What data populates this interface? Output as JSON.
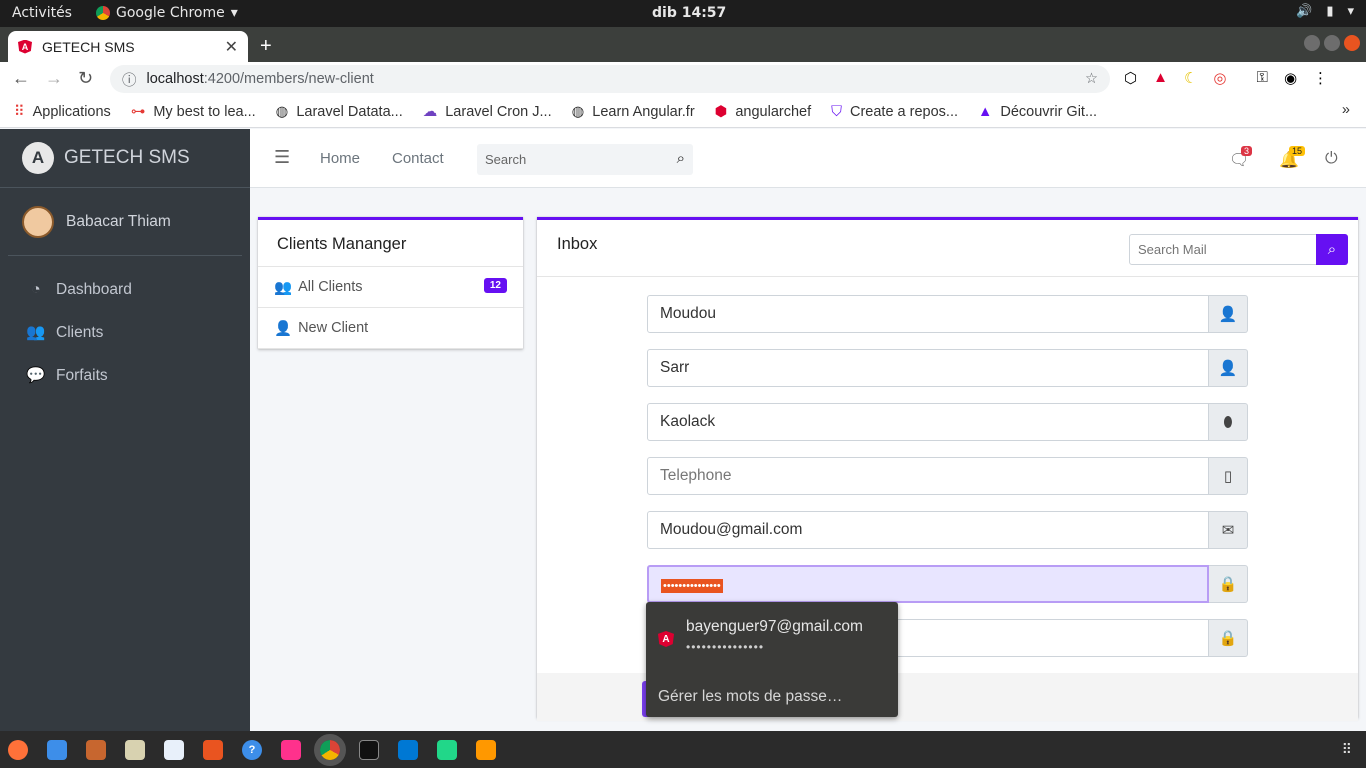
{
  "os": {
    "activities": "Activités",
    "app_name": "Google Chrome",
    "clock": "dib 14:57"
  },
  "browser": {
    "tab_title": "GETECH SMS",
    "url_host": "localhost",
    "url_path": ":4200/members/new-client",
    "bookmarks": [
      {
        "label": "Applications",
        "icon": "apps-grid-icon",
        "color": "#e53935"
      },
      {
        "label": "My best to lea...",
        "icon": "bookmark-icon",
        "color": "#e53935"
      },
      {
        "label": "Laravel Datata...",
        "icon": "globe-icon",
        "color": "#444444"
      },
      {
        "label": "Laravel Cron J...",
        "icon": "cloud-icon",
        "color": "#6f42c1"
      },
      {
        "label": "Learn Angular.fr",
        "icon": "globe-icon",
        "color": "#444444"
      },
      {
        "label": "angularchef",
        "icon": "angular-icon",
        "color": "#dd0031"
      },
      {
        "label": "Create a repos...",
        "icon": "shield-icon",
        "color": "#6610f2"
      },
      {
        "label": "Découvrir Git...",
        "icon": "triangle-icon",
        "color": "#6610f2"
      }
    ]
  },
  "app": {
    "brand": "GETECH SMS",
    "user_name": "Babacar Thiam",
    "nav": [
      {
        "label": "Dashboard",
        "icon": "dashboard-icon"
      },
      {
        "label": "Clients",
        "icon": "users-icon"
      },
      {
        "label": "Forfaits",
        "icon": "comments-icon"
      }
    ],
    "topnav": {
      "home": "Home",
      "contact": "Contact",
      "search_placeholder": "Search",
      "messages_count": "3",
      "notifications_count": "15"
    },
    "clients_card": {
      "title": "Clients Mananger",
      "all_clients": "All Clients",
      "all_clients_count": "12",
      "new_client": "New Client"
    },
    "inbox": {
      "title": "Inbox",
      "search_placeholder": "Search Mail",
      "fields": [
        {
          "value": "Moudou",
          "placeholder": "",
          "icon": "user-icon"
        },
        {
          "value": "Sarr",
          "placeholder": "",
          "icon": "user-icon"
        },
        {
          "value": "Kaolack",
          "placeholder": "",
          "icon": "map-marker-icon"
        },
        {
          "value": "",
          "placeholder": "Telephone",
          "icon": "mobile-icon"
        },
        {
          "value": "Moudou@gmail.com",
          "placeholder": "",
          "icon": "envelope-icon"
        },
        {
          "value": "•••••••••••••••",
          "placeholder": "",
          "icon": "lock-icon"
        },
        {
          "value": "",
          "placeholder": "",
          "icon": "lock-icon"
        }
      ]
    }
  },
  "autocomplete": {
    "email": "bayenguer97@gmail.com",
    "password_mask": "•••••••••••••••",
    "manage_label": "Gérer les mots de passe…"
  },
  "colors": {
    "accent": "#6610f2",
    "sidebar": "#343a40",
    "selection": "#e95420"
  }
}
